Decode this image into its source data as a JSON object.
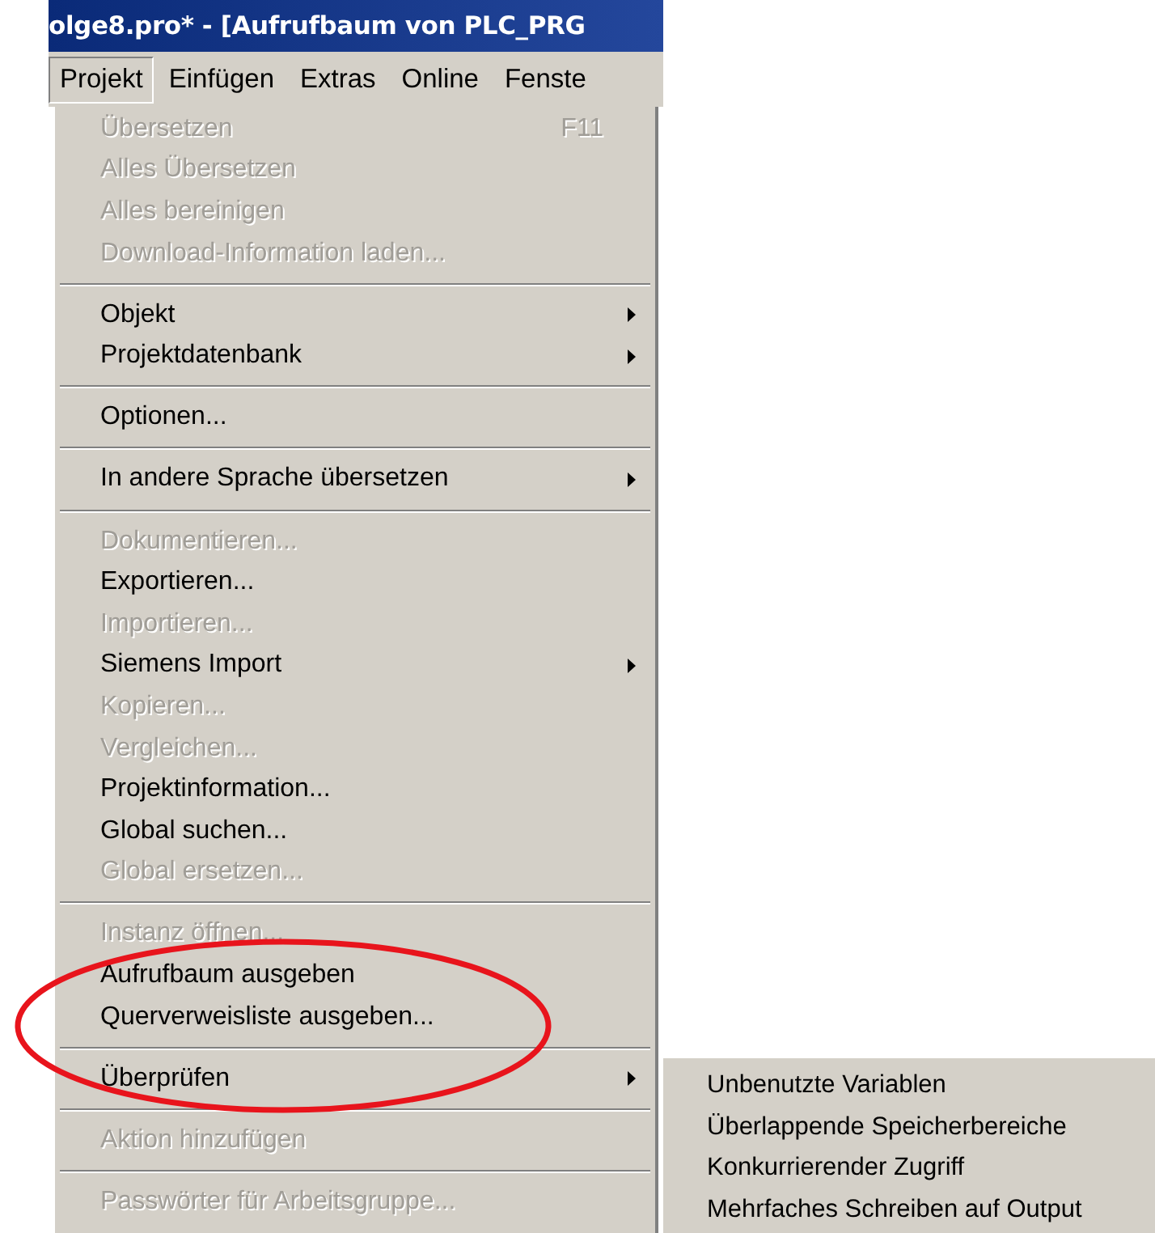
{
  "window": {
    "title": "olge8.pro* - [Aufrufbaum von PLC_PRG"
  },
  "menubar": [
    {
      "label": "Projekt",
      "selected": true
    },
    {
      "label": "Einfügen",
      "selected": false
    },
    {
      "label": "Extras",
      "selected": false
    },
    {
      "label": "Online",
      "selected": false
    },
    {
      "label": "Fenste",
      "selected": false
    }
  ],
  "menu": {
    "groups": [
      [
        {
          "label": "Übersetzen",
          "disabled": true,
          "shortcut": "F11"
        },
        {
          "label": "Alles Übersetzen",
          "disabled": true
        },
        {
          "label": "Alles bereinigen",
          "disabled": true
        },
        {
          "label": "Download-Information laden...",
          "disabled": true
        }
      ],
      [
        {
          "label": "Objekt",
          "disabled": false,
          "submenu": true
        },
        {
          "label": "Projektdatenbank",
          "disabled": false,
          "submenu": true
        }
      ],
      [
        {
          "label": "Optionen...",
          "disabled": false
        }
      ],
      [
        {
          "label": "In andere Sprache übersetzen",
          "disabled": false,
          "submenu": true
        }
      ],
      [
        {
          "label": "Dokumentieren...",
          "disabled": true
        },
        {
          "label": "Exportieren...",
          "disabled": false
        },
        {
          "label": "Importieren...",
          "disabled": true
        },
        {
          "label": "Siemens Import",
          "disabled": false,
          "submenu": true
        },
        {
          "label": "Kopieren...",
          "disabled": true
        },
        {
          "label": "Vergleichen...",
          "disabled": true
        },
        {
          "label": "Projektinformation...",
          "disabled": false
        },
        {
          "label": "Global suchen...",
          "disabled": false
        },
        {
          "label": "Global ersetzen...",
          "disabled": true
        }
      ],
      [
        {
          "label": "Instanz öffnen...",
          "disabled": true
        },
        {
          "label": "Aufrufbaum ausgeben",
          "disabled": false
        },
        {
          "label": "Querverweisliste ausgeben...",
          "disabled": false
        }
      ],
      [
        {
          "label": "Überprüfen",
          "disabled": false,
          "submenu": true
        }
      ],
      [
        {
          "label": "Aktion hinzufügen",
          "disabled": true
        }
      ],
      [
        {
          "label": "Passwörter für Arbeitsgruppe...",
          "disabled": true
        }
      ]
    ]
  },
  "submenu": {
    "items": [
      {
        "label": "Unbenutzte Variablen"
      },
      {
        "label": "Überlappende Speicherbereiche"
      },
      {
        "label": "Konkurrierender Zugriff"
      },
      {
        "label": "Mehrfaches Schreiben auf Output"
      }
    ]
  },
  "annotation": {
    "kind": "ellipse",
    "color": "#e8141c"
  }
}
